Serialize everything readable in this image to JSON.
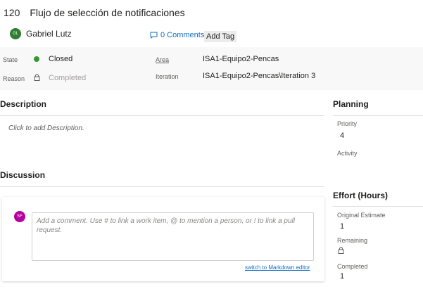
{
  "work_item": {
    "id": "120",
    "title": "Flujo de selección de notificaciones",
    "assignee": {
      "initials": "GL",
      "name": "Gabriel Lutz",
      "avatar_color": "#2e7d32"
    },
    "comments_label": "0 Comments",
    "add_tag_label": "Add Tag"
  },
  "fields": {
    "state_label": "State",
    "state_value": "Closed",
    "state_color": "#339933",
    "reason_label": "Reason",
    "reason_value": "Completed",
    "area_label": "Area",
    "area_value": "ISA1-Equipo2-Pencas",
    "iteration_label": "Iteration",
    "iteration_value": "ISA1-Equipo2-Pencas\\Iteration 3"
  },
  "description": {
    "heading": "Description",
    "placeholder": "Click to add Description."
  },
  "discussion": {
    "heading": "Discussion",
    "avatar_initials": "SF",
    "avatar_color": "#b4009e",
    "comment_placeholder": "Add a comment. Use # to link a work item, @ to mention a person, or ! to link a pull request.",
    "markdown_link": "switch to Markdown editor"
  },
  "planning": {
    "heading": "Planning",
    "priority_label": "Priority",
    "priority_value": "4",
    "activity_label": "Activity"
  },
  "effort": {
    "heading": "Effort (Hours)",
    "original_estimate_label": "Original Estimate",
    "original_estimate_value": "1",
    "remaining_label": "Remaining",
    "completed_label": "Completed",
    "completed_value": "1"
  }
}
